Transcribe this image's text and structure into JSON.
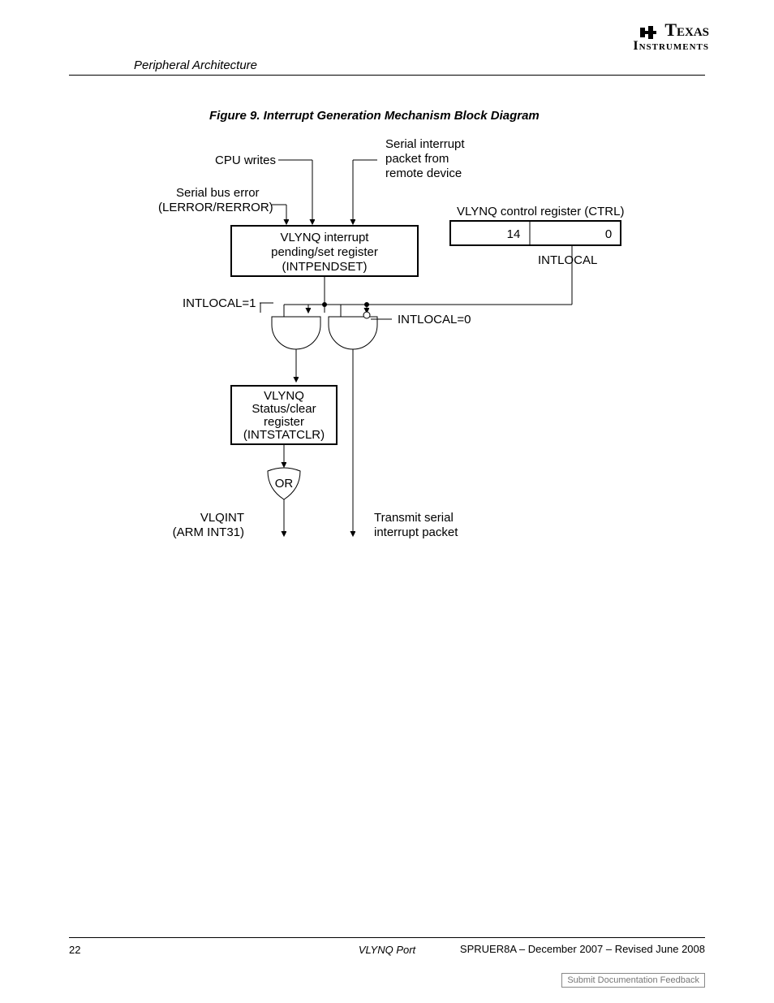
{
  "logo": {
    "line1": "Texas",
    "line2": "Instruments"
  },
  "section_header": "Peripheral Architecture",
  "figure_caption": "Figure 9. Interrupt Generation Mechanism Block Diagram",
  "labels": {
    "cpu_writes": "CPU writes",
    "serial_bus_error_l1": "Serial bus error",
    "serial_bus_error_l2": "(LERROR/RERROR)",
    "serial_pkt_l1": "Serial interrupt",
    "serial_pkt_l2": "packet from",
    "serial_pkt_l3": "remote device",
    "ctrl_caption": "VLYNQ control register (CTRL)",
    "bit14": "14",
    "bit0": "0",
    "intlocal": "INTLOCAL",
    "pendset_l1": "VLYNQ interrupt",
    "pendset_l2": "pending/set register",
    "pendset_l3": "(INTPENDSET)",
    "intlocal1": "INTLOCAL=1",
    "intlocal0": "INTLOCAL=0",
    "statclr_l1": "VLYNQ",
    "statclr_l2": "Status/clear",
    "statclr_l3": "register",
    "statclr_l4": "(INTSTATCLR)",
    "or": "OR",
    "vlqint_l1": "VLQINT",
    "vlqint_l2": "(ARM INT31)",
    "tx_l1": "Transmit serial",
    "tx_l2": "interrupt packet"
  },
  "footer": {
    "page": "22",
    "title": "VLYNQ Port",
    "doc_l1": "SPRUER8A – December 2007 – Revised June 2008",
    "feedback": "Submit Documentation Feedback"
  }
}
